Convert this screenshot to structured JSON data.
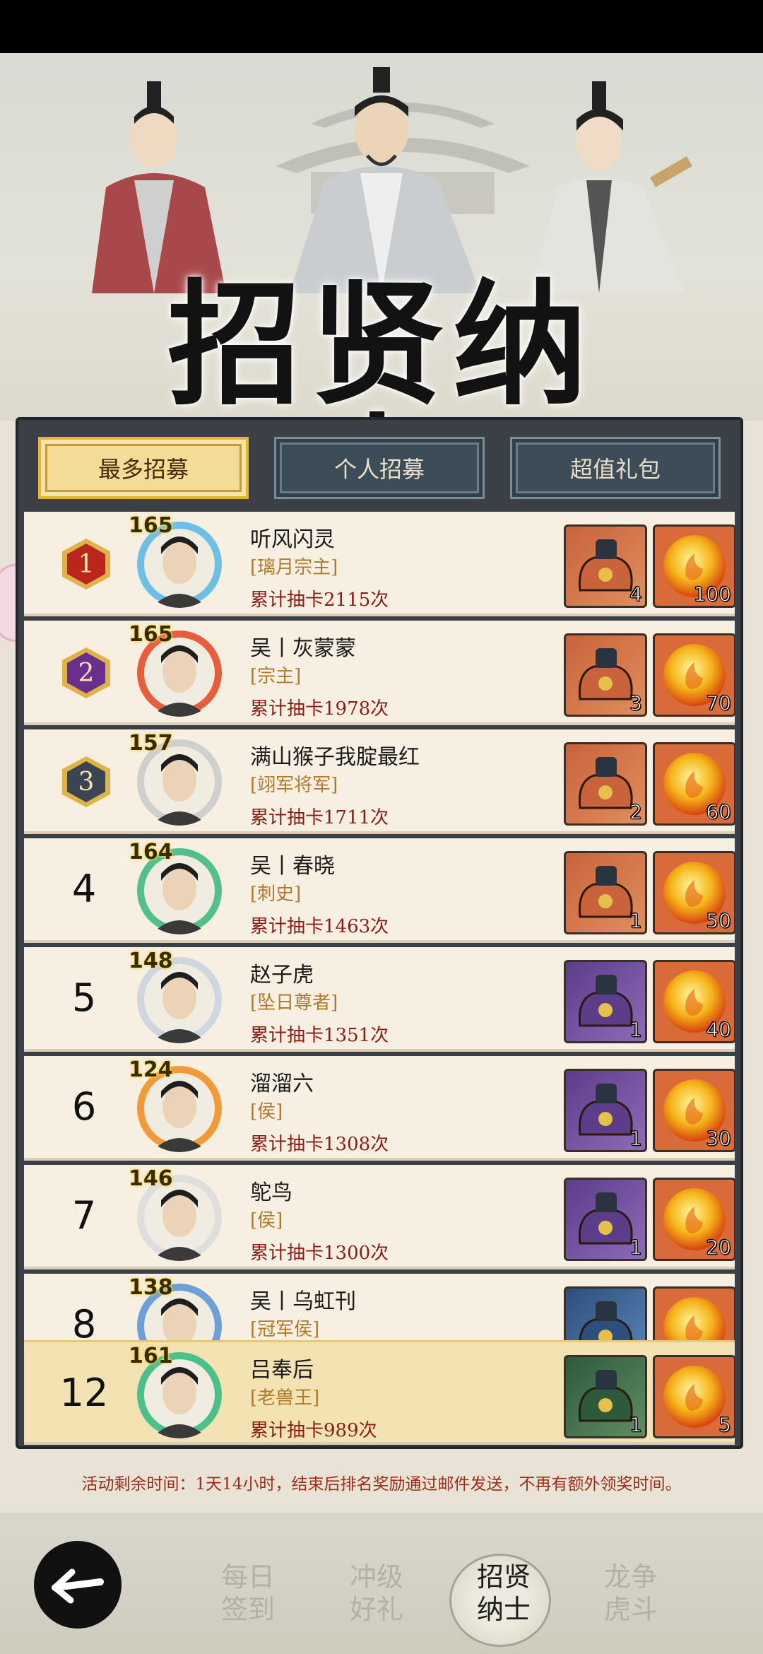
{
  "banner": {
    "title": "招贤纳士"
  },
  "tabs": [
    {
      "label": "最多招募",
      "active": true
    },
    {
      "label": "个人招募",
      "active": false
    },
    {
      "label": "超值礼包",
      "active": false
    }
  ],
  "ranking": [
    {
      "rank": "1",
      "level": "165",
      "name": "听风闪灵",
      "title": "[璃月宗主]",
      "count": "累计抽卡2115次",
      "reward1_qty": "4",
      "reward2_qty": "100",
      "bag": "orange"
    },
    {
      "rank": "2",
      "level": "165",
      "name": "吴丨灰蒙蒙",
      "title": "[宗主]",
      "count": "累计抽卡1978次",
      "reward1_qty": "3",
      "reward2_qty": "70",
      "bag": "orange"
    },
    {
      "rank": "3",
      "level": "157",
      "name": "满山猴子我腚最红",
      "title": "[翊军将军]",
      "count": "累计抽卡1711次",
      "reward1_qty": "2",
      "reward2_qty": "60",
      "bag": "orange"
    },
    {
      "rank": "4",
      "level": "164",
      "name": "吴丨春晓",
      "title": "[刺史]",
      "count": "累计抽卡1463次",
      "reward1_qty": "1",
      "reward2_qty": "50",
      "bag": "orange"
    },
    {
      "rank": "5",
      "level": "148",
      "name": "赵子虎",
      "title": "[坠日尊者]",
      "count": "累计抽卡1351次",
      "reward1_qty": "1",
      "reward2_qty": "40",
      "bag": "purple"
    },
    {
      "rank": "6",
      "level": "124",
      "name": "溜溜六",
      "title": "[侯]",
      "count": "累计抽卡1308次",
      "reward1_qty": "1",
      "reward2_qty": "30",
      "bag": "purple"
    },
    {
      "rank": "7",
      "level": "146",
      "name": "鸵鸟",
      "title": "[侯]",
      "count": "累计抽卡1300次",
      "reward1_qty": "1",
      "reward2_qty": "20",
      "bag": "purple"
    },
    {
      "rank": "8",
      "level": "138",
      "name": "吴丨乌虹刊",
      "title": "[冠军侯]",
      "count": "",
      "reward1_qty": "",
      "reward2_qty": "",
      "bag": "blue"
    }
  ],
  "my_rank": {
    "rank": "12",
    "level": "161",
    "name": "吕奉后",
    "title": "[老兽王]",
    "count": "累计抽卡989次",
    "reward1_qty": "1",
    "reward2_qty": "5",
    "bag": "green"
  },
  "notice": "活动剩余时间：1天14小时，结束后排名奖励通过邮件发送，不再有额外领奖时间。",
  "nav": [
    {
      "line1": "每日",
      "line2": "签到",
      "active": false
    },
    {
      "line1": "冲级",
      "line2": "好礼",
      "active": false
    },
    {
      "line1": "招贤",
      "line2": "纳士",
      "active": true
    },
    {
      "line1": "龙争",
      "line2": "虎斗",
      "active": false
    }
  ],
  "colors": {
    "accent": "#e8b52f",
    "count_red": "#8a1c16",
    "title_gold": "#b07a2c",
    "panel": "#3b4046"
  },
  "icons": {
    "back": "back-arrow-icon",
    "reward1": "treasure-bag-icon",
    "reward2": "fire-orb-icon"
  }
}
